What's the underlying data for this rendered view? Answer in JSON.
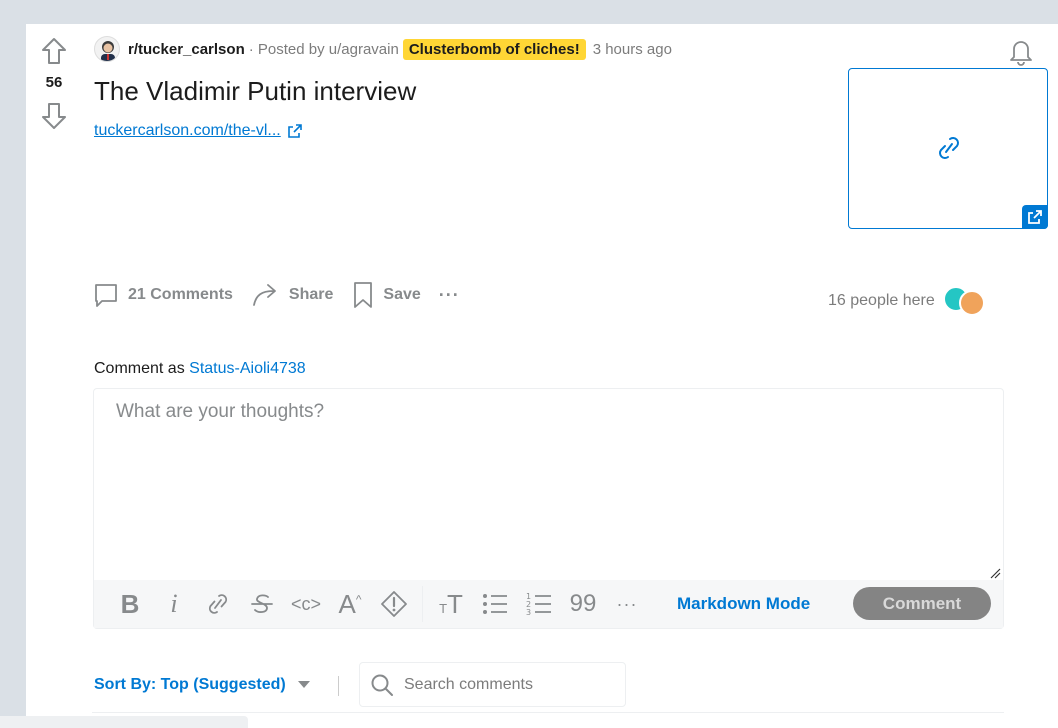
{
  "post": {
    "score": "56",
    "subreddit": "r/tucker_carlson",
    "posted_by": "· Posted by u/agravain",
    "flair": "Clusterbomb of cliches!",
    "age": "3 hours ago",
    "title": "The Vladimir Putin interview",
    "link_text": "tuckercarlson.com/the-vl...",
    "colors": {
      "accent": "#0079d3",
      "flair_bg": "#ffd635"
    }
  },
  "actions": {
    "comments": "21 Comments",
    "share": "Share",
    "save": "Save",
    "more": "···"
  },
  "presence": {
    "text": "16 people here"
  },
  "composer": {
    "comment_as_label": "Comment as",
    "username": "Status-Aioli4738",
    "placeholder": "What are your thoughts?",
    "markdown_mode": "Markdown Mode",
    "submit": "Comment",
    "toolbar_icons": [
      "bold-icon",
      "italic-icon",
      "link-icon",
      "strikethrough-icon",
      "inline-code-icon",
      "superscript-icon",
      "spoiler-icon",
      "heading-icon",
      "bulleted-list-icon",
      "numbered-list-icon",
      "quote-icon",
      "more-icon"
    ]
  },
  "comments_header": {
    "sort_label": "Sort By: Top (Suggested)",
    "search_placeholder": "Search comments"
  }
}
